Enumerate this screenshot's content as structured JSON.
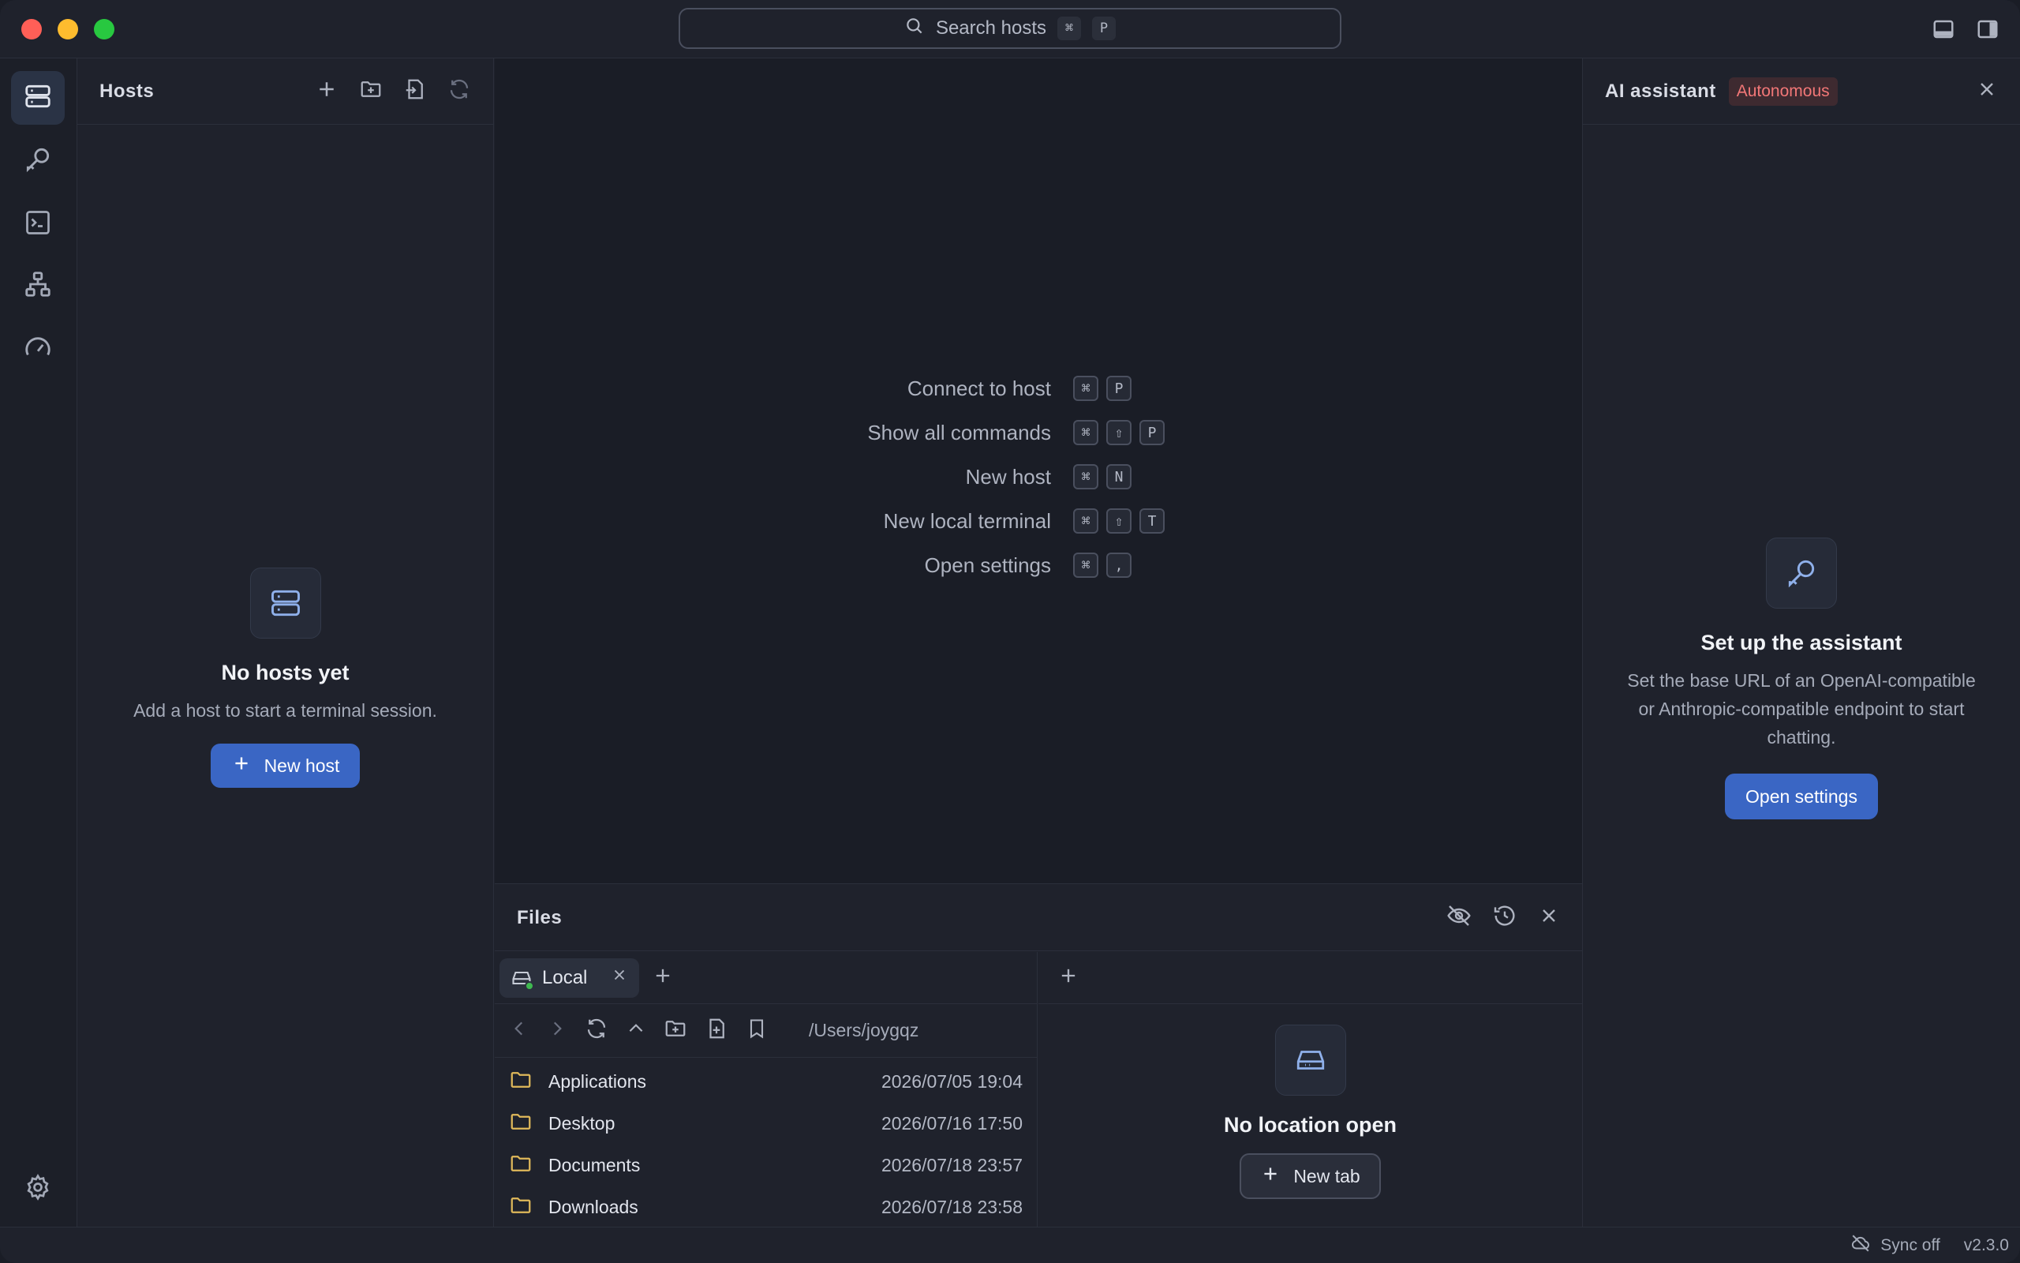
{
  "titlebar": {
    "search_placeholder": "Search hosts",
    "search_keys": [
      "⌘",
      "P"
    ]
  },
  "activity": {
    "items": [
      "hosts-icon",
      "key-icon",
      "terminal-icon",
      "network-icon",
      "gauge-icon"
    ],
    "bottom": "gear-icon"
  },
  "hosts": {
    "title": "Hosts",
    "empty_title": "No hosts yet",
    "empty_desc": "Add a host to start a terminal session.",
    "new_button": "New host"
  },
  "welcome": {
    "shortcuts": [
      {
        "label": "Connect to host",
        "keys": [
          "⌘",
          "P"
        ]
      },
      {
        "label": "Show all commands",
        "keys": [
          "⌘",
          "⇧",
          "P"
        ]
      },
      {
        "label": "New host",
        "keys": [
          "⌘",
          "N"
        ]
      },
      {
        "label": "New local terminal",
        "keys": [
          "⌘",
          "⇧",
          "T"
        ]
      },
      {
        "label": "Open settings",
        "keys": [
          "⌘",
          ","
        ]
      }
    ]
  },
  "files": {
    "title": "Files",
    "tab_label": "Local",
    "path": "/Users/joygqz",
    "rows": [
      {
        "name": "Applications",
        "date": "2026/07/05 19:04"
      },
      {
        "name": "Desktop",
        "date": "2026/07/16 17:50"
      },
      {
        "name": "Documents",
        "date": "2026/07/18 23:57"
      },
      {
        "name": "Downloads",
        "date": "2026/07/18 23:58"
      }
    ],
    "right_empty_title": "No location open",
    "right_new_tab": "New tab"
  },
  "ai": {
    "title": "AI assistant",
    "badge": "Autonomous",
    "empty_title": "Set up the assistant",
    "empty_desc_1": "Set the base URL of an OpenAI-compatible",
    "empty_desc_2": "or Anthropic-compatible endpoint to start",
    "empty_desc_3": "chatting.",
    "open_settings": "Open settings"
  },
  "statusbar": {
    "sync": "Sync off",
    "version": "v2.3.0"
  },
  "colors": {
    "accent": "#3a66c4",
    "badge_text": "#f27777",
    "folder": "#e0b95a",
    "online": "#3fb950"
  }
}
